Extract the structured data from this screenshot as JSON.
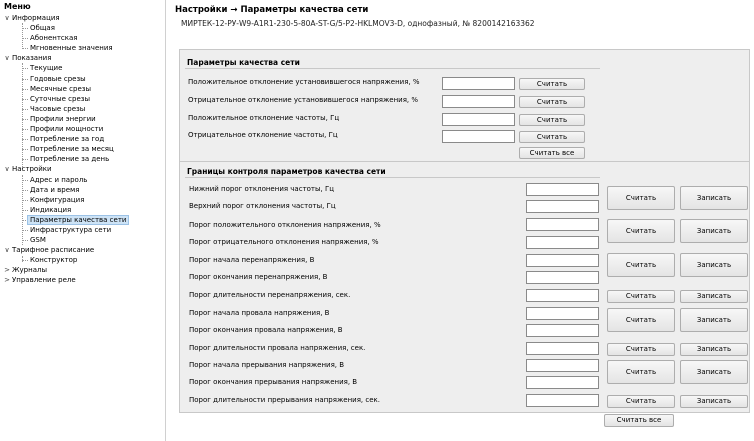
{
  "sidebar": {
    "title": "Меню",
    "items": [
      {
        "label": "Информация",
        "arrow": "∨"
      },
      {
        "label": "Общая"
      },
      {
        "label": "Абонентская"
      },
      {
        "label": "Мгновенные значения"
      },
      {
        "label": "Показания",
        "arrow": "∨"
      },
      {
        "label": "Текущие"
      },
      {
        "label": "Годовые срезы"
      },
      {
        "label": "Месячные срезы"
      },
      {
        "label": "Суточные срезы"
      },
      {
        "label": "Часовые срезы"
      },
      {
        "label": "Профили энергии"
      },
      {
        "label": "Профили мощности"
      },
      {
        "label": "Потребление за год"
      },
      {
        "label": "Потребление за месяц"
      },
      {
        "label": "Потребление за день"
      },
      {
        "label": "Настройки",
        "arrow": "∨"
      },
      {
        "label": "Адрес и пароль"
      },
      {
        "label": "Дата и время"
      },
      {
        "label": "Конфигурация"
      },
      {
        "label": "Индикация"
      },
      {
        "label": "Параметры качества сети"
      },
      {
        "label": "Инфраструктура сети"
      },
      {
        "label": "GSM"
      },
      {
        "label": "Тарифное расписание",
        "arrow": "∨"
      },
      {
        "label": "Конструктор"
      },
      {
        "label": "Журналы",
        "arrow": ">"
      },
      {
        "label": "Управление реле",
        "arrow": ">"
      }
    ]
  },
  "header": {
    "title": "Настройки → Параметры качества сети",
    "device": "МИРТЕК-12-РУ-W9-A1R1-230-5-80A-ST-G/5-P2-HKLMOV3-D, однофазный, № 8200142163362"
  },
  "quality": {
    "heading": "Параметры качества сети",
    "rows": [
      {
        "label": "Положительное отклонение установившегося напряжения, %",
        "value": ""
      },
      {
        "label": "Отрицательное отклонение установившегося напряжения, %",
        "value": ""
      },
      {
        "label": "Положительное отклонение частоты, Гц",
        "value": ""
      },
      {
        "label": "Отрицательное отклонение частоты, Гц",
        "value": ""
      }
    ],
    "read_label": "Считать",
    "read_all_label": "Считать все"
  },
  "limits": {
    "heading": "Границы контроля параметров качества сети",
    "rows": [
      {
        "label": "Нижний порог отклонения частоты, Гц",
        "value": ""
      },
      {
        "label": "Верхний порог отклонения частоты, Гц",
        "value": ""
      },
      {
        "label": "Порог положительного отклонения напряжения, %",
        "value": ""
      },
      {
        "label": "Порог отрицательного отклонения напряжения, %",
        "value": ""
      },
      {
        "label": "Порог начала перенапряжения, В",
        "value": ""
      },
      {
        "label": "Порог окончания перенапряжения, В",
        "value": ""
      },
      {
        "label": "Порог длительности перенапряжения, сек.",
        "value": ""
      },
      {
        "label": "Порог начала провала напряжения, В",
        "value": ""
      },
      {
        "label": "Порог окончания провала напряжения, В",
        "value": ""
      },
      {
        "label": "Порог длительности провала напряжения, сек.",
        "value": ""
      },
      {
        "label": "Порог начала прерывания напряжения, В",
        "value": ""
      },
      {
        "label": "Порог окончания прерывания напряжения, В",
        "value": ""
      },
      {
        "label": "Порог длительности прерывания напряжения, сек.",
        "value": ""
      }
    ],
    "read_label": "Считать",
    "write_label": "Записать",
    "read_all_label": "Считать все"
  }
}
